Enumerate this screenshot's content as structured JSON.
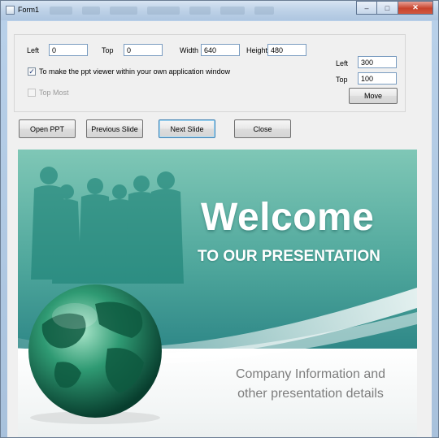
{
  "window": {
    "title": "Form1"
  },
  "position_group": {
    "left_label": "Left",
    "left_value": "0",
    "top_label": "Top",
    "top_value": "0",
    "width_label": "Width",
    "width_value": "640",
    "height_label": "Height",
    "height_value": "480",
    "embed_checkbox_label": "To make the ppt viewer within your own application window",
    "embed_checked": true,
    "topmost_label": "Top Most",
    "topmost_checked": false
  },
  "move_panel": {
    "left_label": "Left",
    "left_value": "300",
    "top_label": "Top",
    "top_value": "100",
    "move_button": "Move"
  },
  "toolbar": {
    "open_button": "Open PPT",
    "previous_button": "Previous Slide",
    "next_button": "Next Slide",
    "close_button": "Close"
  },
  "slide": {
    "title": "Welcome",
    "subtitle": "TO OUR PRESENTATION",
    "body_line1": "Company Information and",
    "body_line2": "other presentation details"
  },
  "colors": {
    "slide_teal": "#2e8787",
    "slide_light_teal": "#7fc7b6",
    "body_text": "#7d7d7d"
  }
}
